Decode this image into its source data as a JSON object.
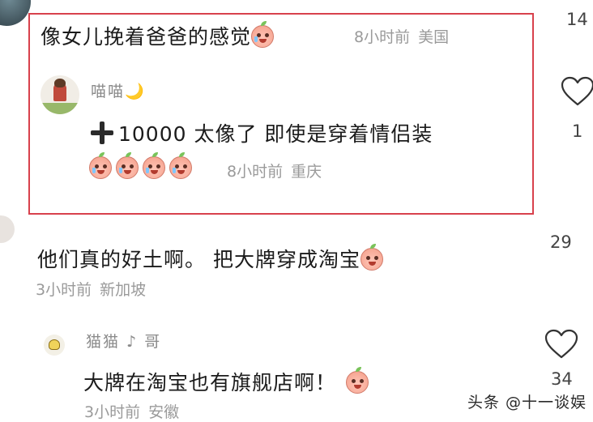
{
  "comments": [
    {
      "text": "像女儿挽着爸爸的感觉",
      "time": "8小时前",
      "location": "美国",
      "likes": "14",
      "emoji": "crying-peach-emoji"
    },
    {
      "text": "他们真的好土啊。 把大牌穿成淘宝",
      "time": "3小时前",
      "location": "新加坡",
      "likes": "29",
      "emoji": "covering-mouth-peach-emoji"
    }
  ],
  "reply_1": {
    "username": "喵喵🌙",
    "text": "10000 太像了 即使是穿着情侣装",
    "time": "8小时前",
    "location": "重庆",
    "likes": "1",
    "emoji_count": 4
  },
  "reply_2": {
    "username": "猫猫 ♪ 哥",
    "text": "大牌在淘宝也有旗舰店啊！",
    "time": "3小时前",
    "location": "安徽",
    "likes": "34"
  },
  "watermark": "头条 @十一谈娱",
  "colors": {
    "highlight_border": "#d8414c",
    "meta_gray": "#9a9a9a"
  }
}
